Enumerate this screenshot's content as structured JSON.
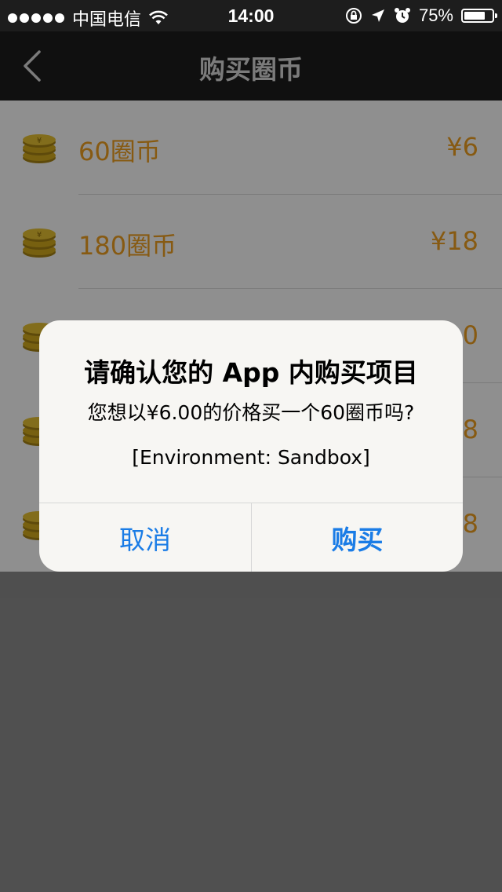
{
  "status_bar": {
    "carrier": "中国电信",
    "time": "14:00",
    "battery_percent": "75%",
    "battery_level": 0.75,
    "signal_bars": 5,
    "icons": [
      "wifi-icon",
      "orientation-lock-icon",
      "location-arrow-icon",
      "alarm-icon",
      "battery-icon"
    ]
  },
  "navbar": {
    "title": "购买圈币",
    "back_icon": "chevron-left-icon"
  },
  "products": [
    {
      "name": "60圈币",
      "price": "¥6"
    },
    {
      "name": "180圈币",
      "price": "¥18"
    },
    {
      "name": "",
      "price": "0"
    },
    {
      "name": "",
      "price": "8"
    },
    {
      "name": "",
      "price": "8"
    }
  ],
  "alert": {
    "title": "请确认您的 App 内购买项目",
    "message": "您想以¥6.00的价格买一个60圈币吗?",
    "environment": "[Environment: Sandbox]",
    "cancel_label": "取消",
    "buy_label": "购买"
  },
  "colors": {
    "accent": "#f0a020",
    "ios_blue": "#1a7ce6",
    "bar_background": "#1d1d1d"
  }
}
